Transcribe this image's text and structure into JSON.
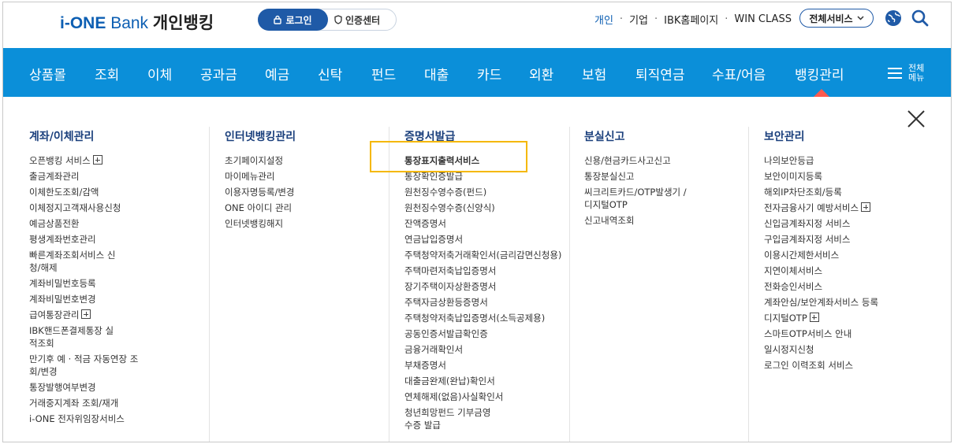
{
  "logo": {
    "brand": "i-ONE",
    "bank": "Bank",
    "kor": "개인뱅킹"
  },
  "login": {
    "login_label": "로그인",
    "cert_label": "인증센터"
  },
  "util": {
    "personal": "개인",
    "business": "기업",
    "homepage": "IBK홈페이지",
    "winclass": "WIN CLASS",
    "all_services": "전체서비스"
  },
  "nav": {
    "items": [
      "상품몰",
      "조회",
      "이체",
      "공과금",
      "예금",
      "신탁",
      "펀드",
      "대출",
      "카드",
      "외환",
      "보험",
      "퇴직연금",
      "수표/어음",
      "뱅킹관리"
    ],
    "all_menu_line1": "전체",
    "all_menu_line2": "메뉴"
  },
  "columns": [
    {
      "title": "계좌/이체관리",
      "items": [
        "오픈뱅킹 서비스",
        "출금계좌관리",
        "이체한도조회/감액",
        "이체정지고객재사용신청",
        "예금상품전환",
        "평생계좌번호관리",
        "빠른계좌조회서비스 신청/해제",
        "계좌비밀번호등록",
        "계좌비밀번호변경",
        "급여통장관리",
        "IBK핸드폰결제통장 실적조회",
        "만기후 예 · 적금 자동연장 조회/변경",
        "통장발행여부변경",
        "거래중지계좌 조회/재개",
        "i-ONE 전자위임장서비스"
      ]
    },
    {
      "title": "인터넷뱅킹관리",
      "items": [
        "초기페이지설정",
        "마이메뉴관리",
        "이용자명등록/변경",
        "ONE 아이디 관리",
        "인터넷뱅킹해지"
      ]
    },
    {
      "title": "증명서발급",
      "items": [
        "통장표지출력서비스",
        "통장확인증발급",
        "원천징수영수증(펀드)",
        "원천징수영수증(신양식)",
        "잔액증명서",
        "연금납입증명서",
        "주택청약저축거래확인서(금리감면신청용)",
        "주택마련저축납입증명서",
        "장기주택이자상환증명서",
        "주택자금상환등증명서",
        "주택청약저축납입증명서(소득공제용)",
        "공동인증서발급확인증",
        "금융거래확인서",
        "부채증명서",
        "대출금완제(완납)확인서",
        "연체해제(없음)사실확인서",
        "청년희망펀드 기부금영수증 발급"
      ]
    },
    {
      "title": "분실신고",
      "items": [
        "신용/현금카드사고신고",
        "통장분실신고",
        "씨크리트카드/OTP발생기 /디지털OTP",
        "신고내역조회"
      ]
    },
    {
      "title": "보안관리",
      "items": [
        "나의보안등급",
        "보안이미지등록",
        "해외IP차단조회/등록",
        "전자금융사기 예방서비스",
        "신입금계좌지정 서비스",
        "구입금계좌지정 서비스",
        "이용시간제한서비스",
        "지연이체서비스",
        "전화승인서비스",
        "계좌안심/보안계좌서비스 등록",
        "디지털OTP",
        "스마트OTP서비스 안내",
        "일시정지신청",
        "로그인 이력조회 서비스"
      ]
    }
  ],
  "colors": {
    "nav_bg": "#0b8fd9",
    "brand_blue": "#1f5aa7",
    "highlight": "#f5b800",
    "pointer": "#ff5a4e"
  }
}
